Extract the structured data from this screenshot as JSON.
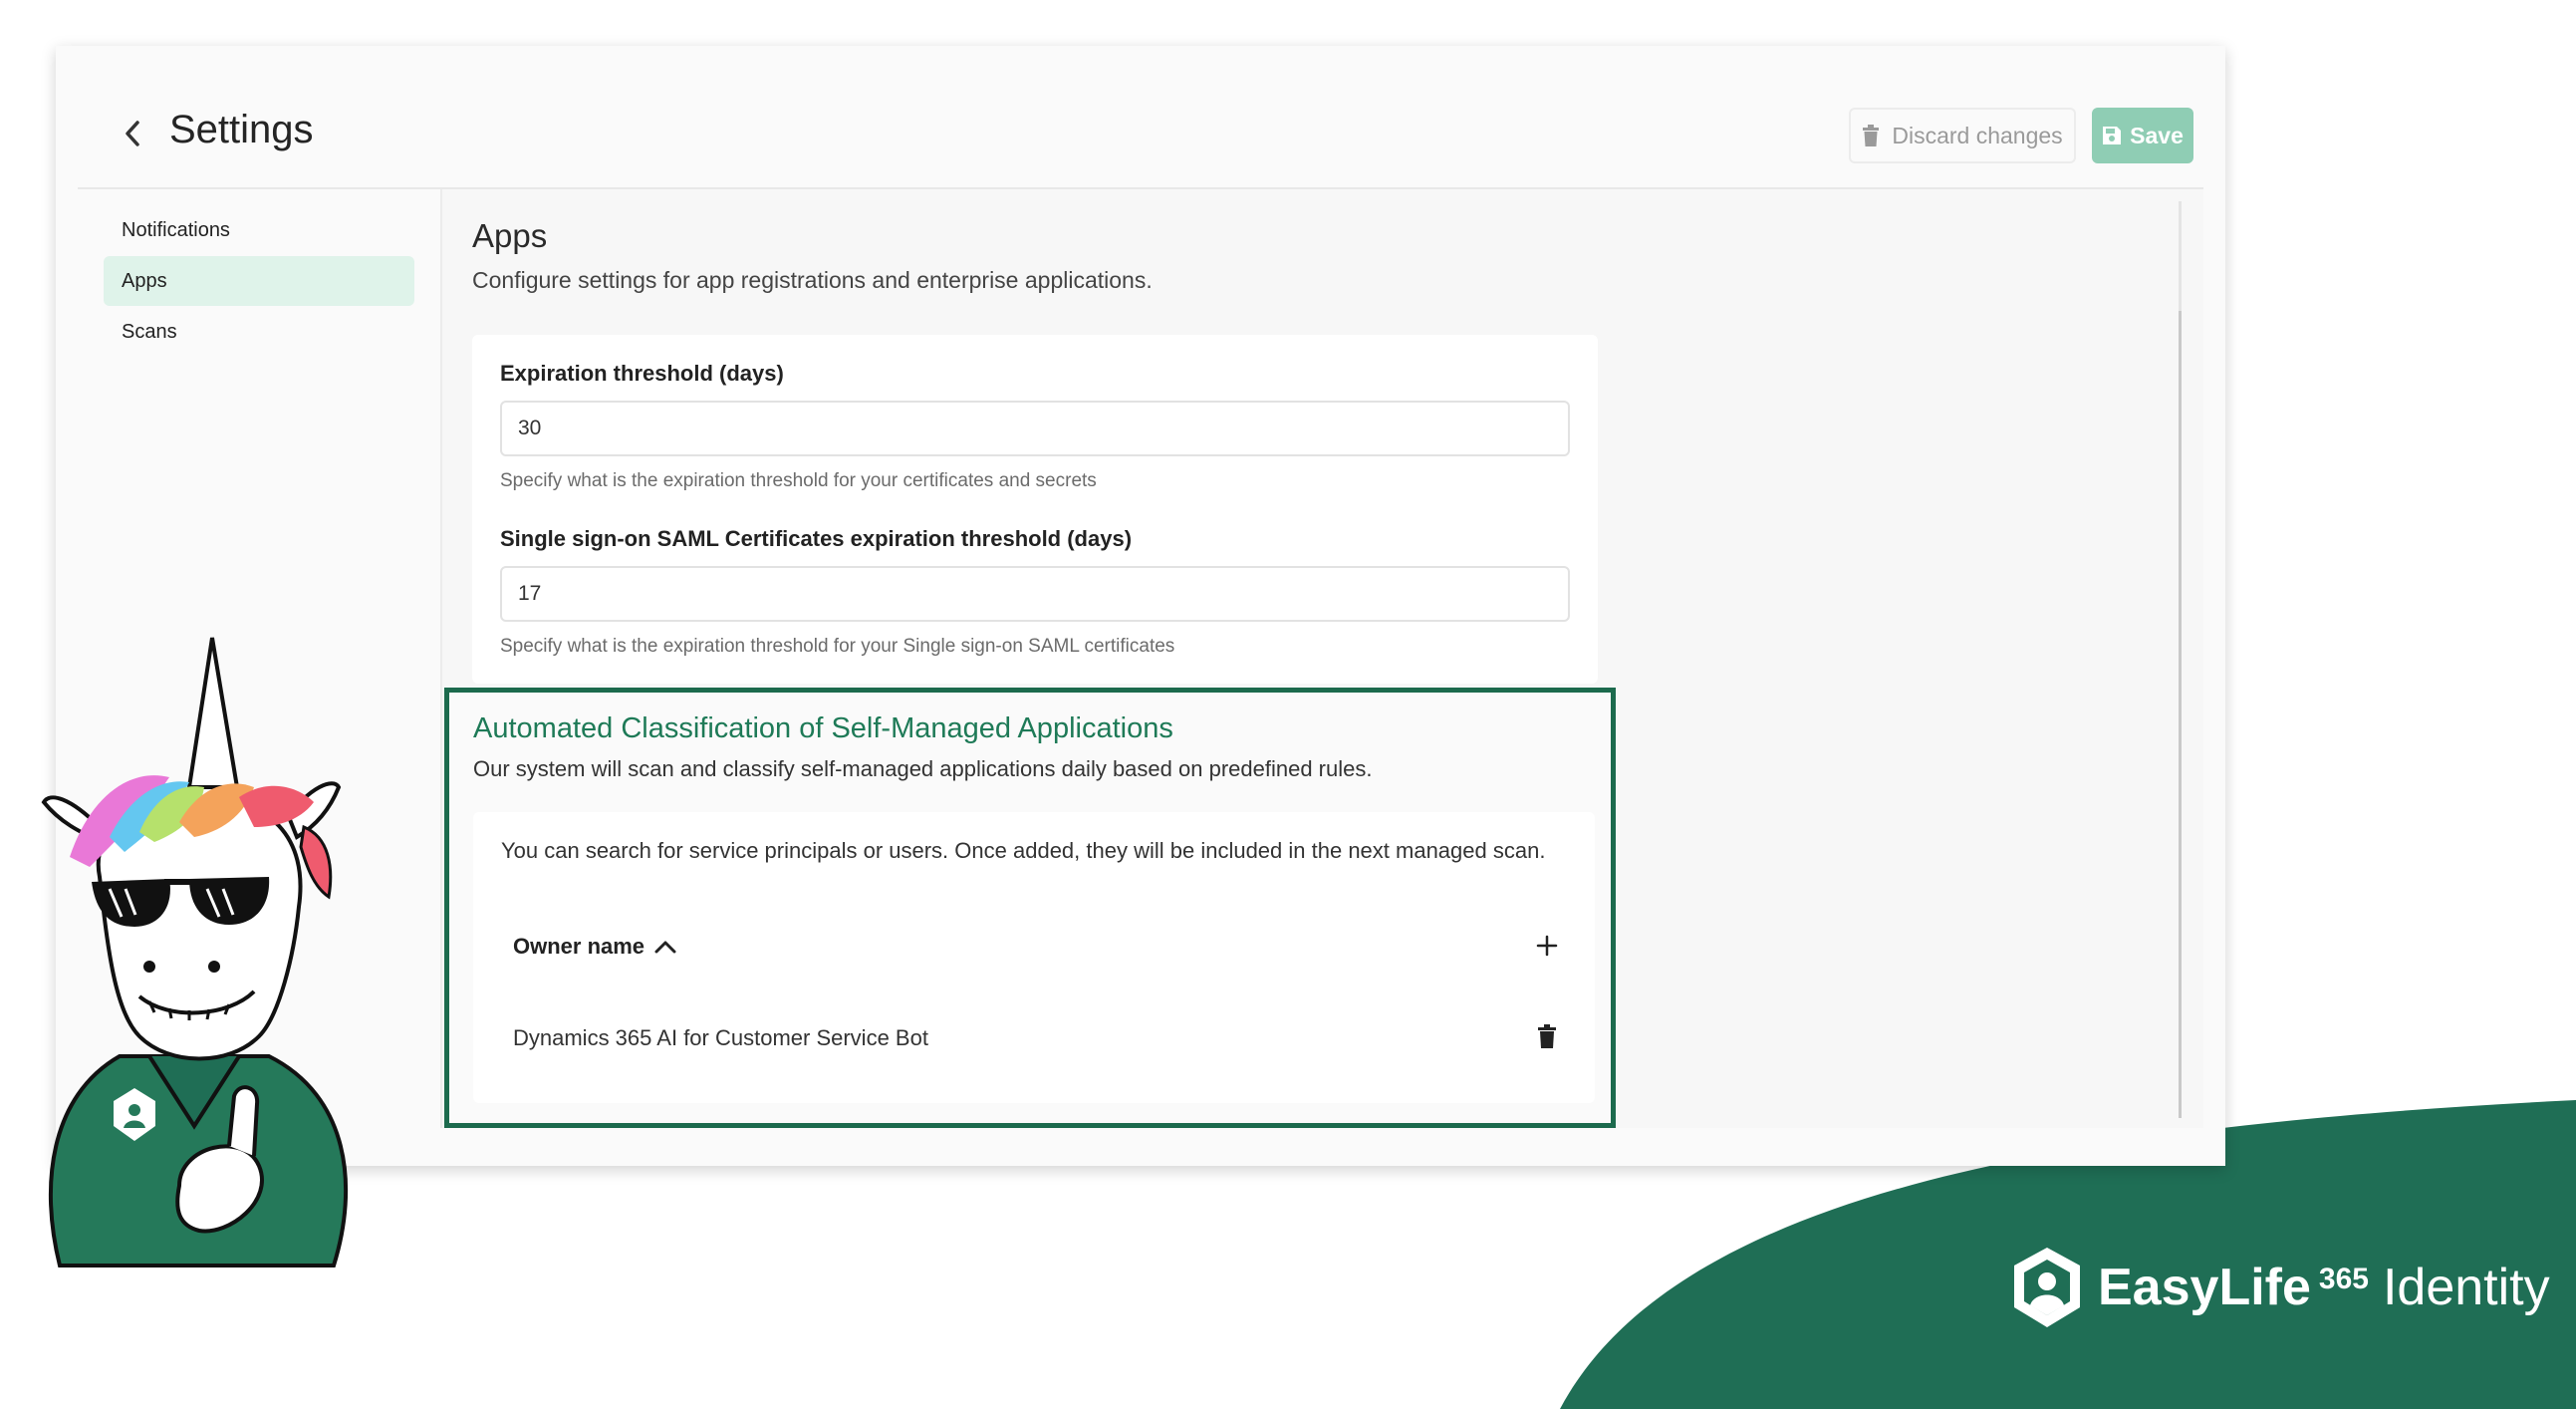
{
  "header": {
    "title": "Settings",
    "discard_label": "Discard changes",
    "save_label": "Save"
  },
  "sidebar": {
    "items": [
      {
        "label": "Notifications",
        "active": false
      },
      {
        "label": "Apps",
        "active": true
      },
      {
        "label": "Scans",
        "active": false
      }
    ]
  },
  "apps": {
    "title": "Apps",
    "subtitle": "Configure settings for app registrations and enterprise applications.",
    "fields": [
      {
        "label": "Expiration threshold (days)",
        "value": "30",
        "help": "Specify what is the expiration threshold for your certificates and secrets"
      },
      {
        "label": "Single sign-on SAML Certificates expiration threshold (days)",
        "value": "17",
        "help": "Specify what is the expiration threshold for your Single sign-on SAML certificates"
      }
    ]
  },
  "classification": {
    "title": "Automated Classification of Self-Managed Applications",
    "subtitle": "Our system will scan and classify self-managed applications daily based on predefined rules.",
    "intro": "You can search for service principals or users. Once added, they will be included in the next managed scan.",
    "column_header": "Owner name",
    "sort": "ascending",
    "rows": [
      {
        "name": "Dynamics 365 AI for Customer Service Bot"
      }
    ]
  },
  "branding": {
    "name": "EasyLife",
    "superscript": "365",
    "product": "Identity"
  },
  "colors": {
    "brand_green": "#1f6e55",
    "highlight_border": "#1c6a4d",
    "active_nav_bg": "#dff3ea",
    "save_button": "#8fcdb4"
  },
  "icons": [
    "back-chevron-icon",
    "trash-icon",
    "save-icon",
    "sort-ascending-icon",
    "plus-icon",
    "delete-icon",
    "shield-logo-icon"
  ]
}
